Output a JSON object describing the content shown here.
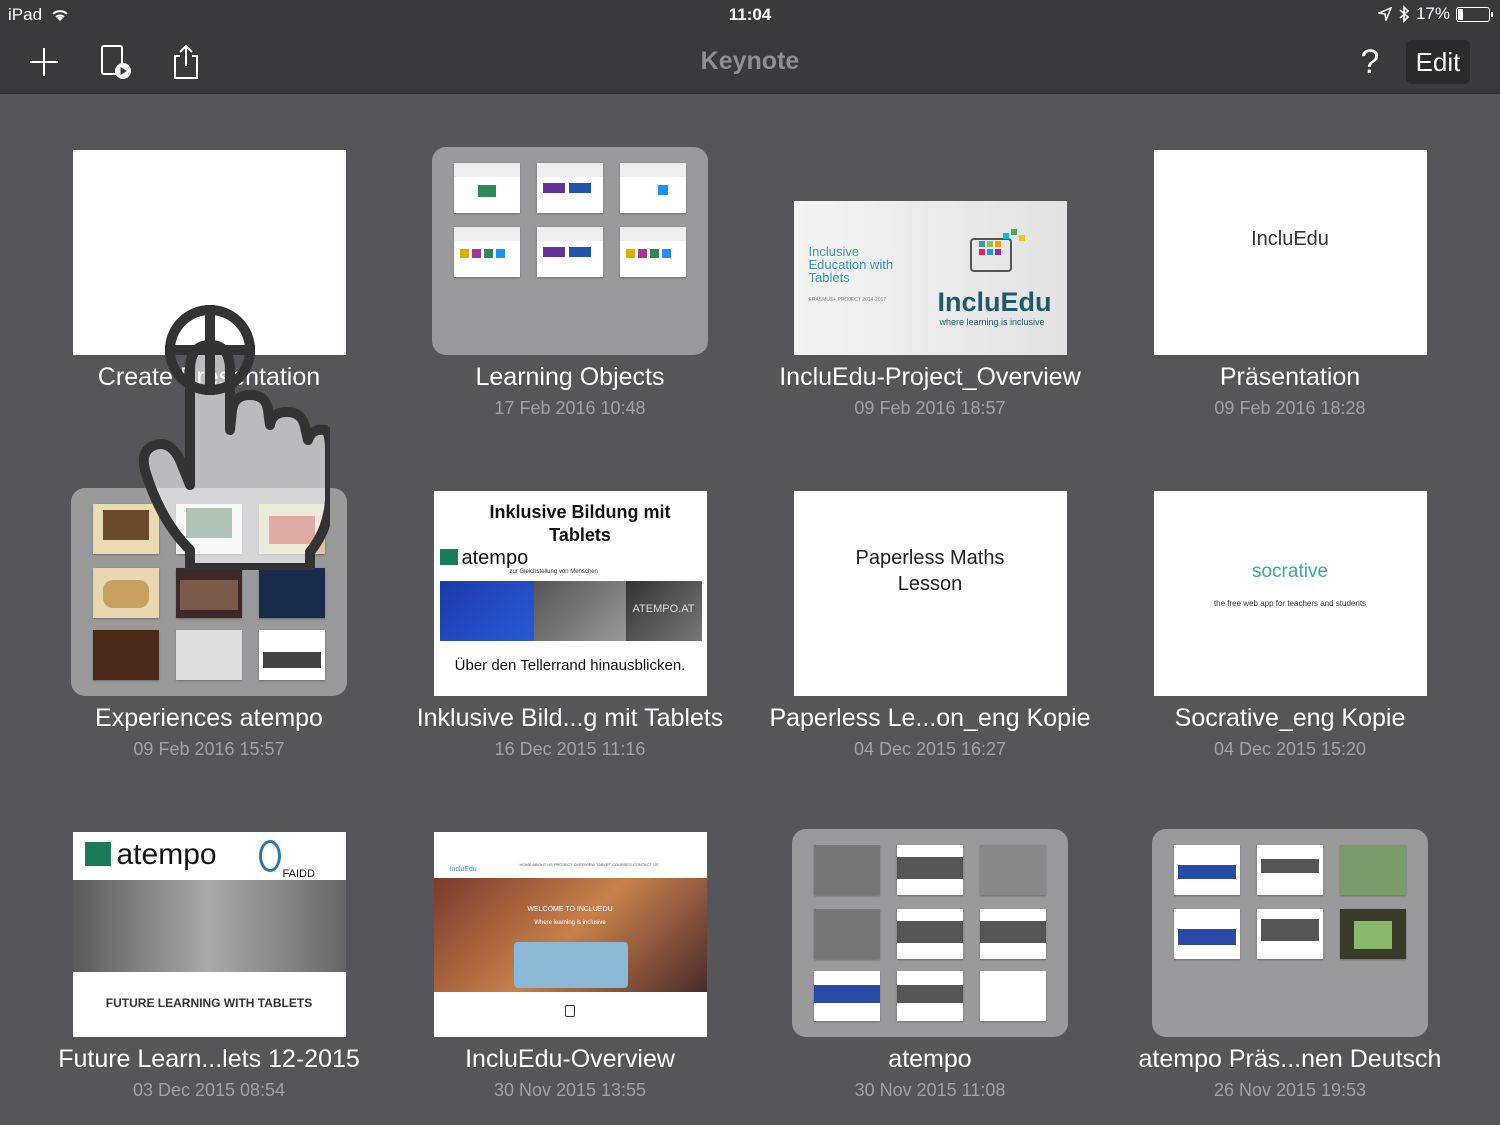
{
  "status": {
    "device": "iPad",
    "time": "11:04",
    "battery": "17%",
    "battery_level": 0.17
  },
  "toolbar": {
    "title": "Keynote",
    "edit_label": "Edit",
    "help_label": "?"
  },
  "create": {
    "label": "Create Presentation"
  },
  "items": [
    {
      "name": "Learning Objects",
      "date": "17 Feb 2016 10:48"
    },
    {
      "name": "IncluEdu-Project_Overview",
      "date": "09 Feb 2016 18:57"
    },
    {
      "name": "Präsentation",
      "date": "09 Feb 2016 18:28"
    },
    {
      "name": "Experiences atempo",
      "date": "09 Feb 2016 15:57"
    },
    {
      "name": "Inklusive Bild...g mit Tablets",
      "date": "16 Dec 2015 11:16"
    },
    {
      "name": "Paperless Le...on_eng Kopie",
      "date": "04 Dec 2015 16:27"
    },
    {
      "name": "Socrative_eng Kopie",
      "date": "04 Dec 2015 15:20"
    },
    {
      "name": "Future Learn...lets 12-2015",
      "date": "03 Dec 2015 08:54"
    },
    {
      "name": "IncluEdu-Overview",
      "date": "30 Nov 2015 13:55"
    },
    {
      "name": "atempo",
      "date": "30 Nov 2015 11:08"
    },
    {
      "name": "atempo Präs...nen Deutsch",
      "date": "26 Nov 2015 19:53"
    }
  ],
  "slides": {
    "incluedu_tagline": "Inclusive Education with Tablets",
    "incluedu_logo": "IncluEdu",
    "incluedu_sub": "where learning is inclusive",
    "incluedu_small": "ERASMUS+ PROJECT 2014-2017",
    "praes_text": "IncluEdu",
    "inklusive_title": "Inklusive Bildung mit Tablets",
    "inklusive_logo": "atempo",
    "inklusive_logo_sub": "zur Gleichstellung von Menschen",
    "inklusive_footer": "Über den Tellerrand hinausblicken.",
    "inklusive_sign": "ATEMPO.AT",
    "paperless_text": "Paperless Maths Lesson",
    "socrative_logo": "socrative",
    "socrative_sub": "the free web app for teachers and students",
    "future_logo": "atempo",
    "future_faidd": "FAIDD",
    "future_footer": "FUTURE LEARNING WITH TABLETS",
    "overview_logo": "IncluEdu",
    "overview_welcome": "WELCOME TO INCLUEDU",
    "overview_sub": "Where learning is inclusive",
    "overview_nav": "HOME   ABOUT US   PROJECT OVERVIEW   TABLET COURSES   CONTACT US"
  },
  "colors": {
    "toolbar": "#3a3a3c",
    "background": "#56565a",
    "folder": "#9a9a9d",
    "incluedu_teal": "#3a9aa8",
    "atempo_green": "#1a7a5a"
  }
}
